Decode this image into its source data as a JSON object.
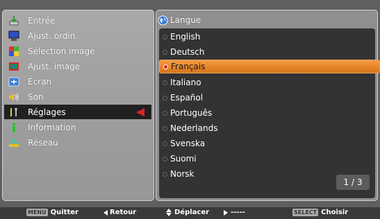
{
  "menu": {
    "items": [
      {
        "label": "Entrée",
        "icon": "input-icon"
      },
      {
        "label": "Ajust. ordin.",
        "icon": "computer-adjust-icon"
      },
      {
        "label": "Sélection image",
        "icon": "image-select-icon"
      },
      {
        "label": "Ajust. image",
        "icon": "image-adjust-icon"
      },
      {
        "label": "Écran",
        "icon": "screen-icon"
      },
      {
        "label": "Son",
        "icon": "sound-icon"
      },
      {
        "label": "Réglages",
        "icon": "settings-icon"
      },
      {
        "label": "Information",
        "icon": "information-icon"
      },
      {
        "label": "Réseau",
        "icon": "network-icon"
      }
    ],
    "selected_index": 6
  },
  "language_panel": {
    "title": "Langue",
    "options": [
      "English",
      "Deutsch",
      "Français",
      "Italiano",
      "Español",
      "Português",
      "Nederlands",
      "Svenska",
      "Suomi",
      "Norsk"
    ],
    "selected": "Français",
    "page": "1 / 3"
  },
  "footer": {
    "quit_key": "MENU",
    "quit_label": "Quitter",
    "back_label": "Retour",
    "move_label": "Déplacer",
    "next_label": "-----",
    "select_key": "SELECT",
    "select_label": "Choisir"
  },
  "colors": {
    "selected_option": "#e8882c",
    "selected_menu_bg": "#202020",
    "selection_arrow": "#e0242c"
  }
}
